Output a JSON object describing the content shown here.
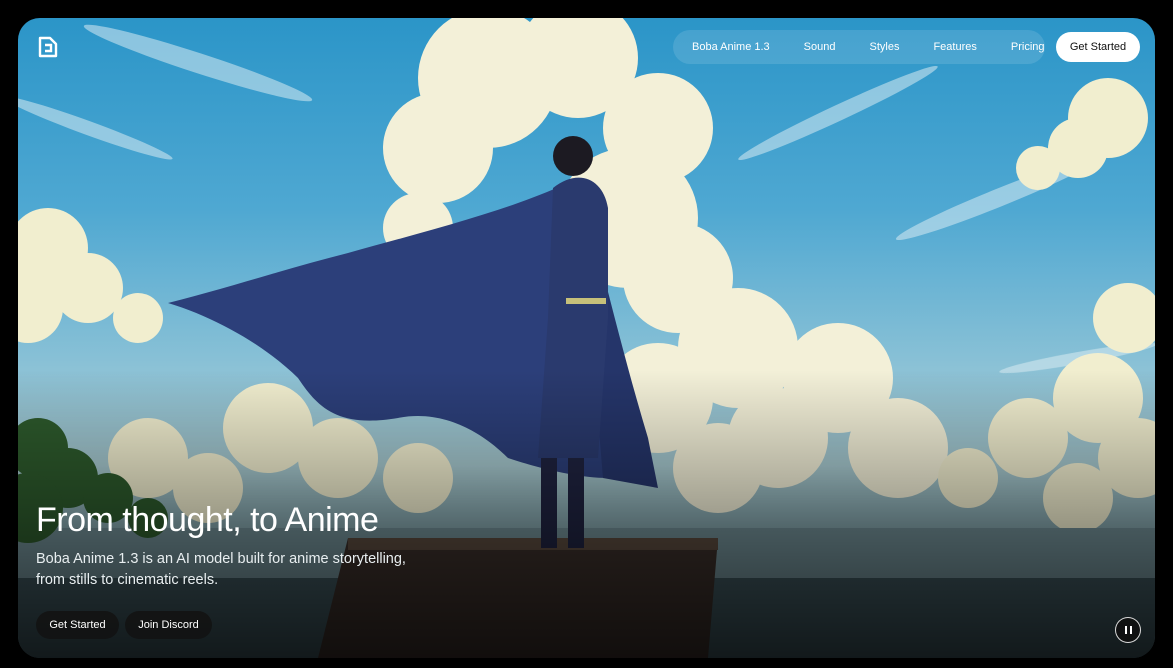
{
  "nav": {
    "items": [
      {
        "label": "Boba Anime 1.3"
      },
      {
        "label": "Sound"
      },
      {
        "label": "Styles"
      },
      {
        "label": "Features"
      },
      {
        "label": "Pricing"
      }
    ],
    "cta_label": "Get Started"
  },
  "hero": {
    "title": "From thought, to Anime",
    "subtitle_line1": "Boba Anime 1.3 is an AI model built for anime storytelling,",
    "subtitle_line2": "from stills to cinematic reels.",
    "primary_label": "Get Started",
    "secondary_label": "Join Discord"
  },
  "media": {
    "control_icon": "pause-icon"
  },
  "colors": {
    "sky": "#2b95c8",
    "cloud": "#f3f0d8",
    "cape": "#2c3f7a",
    "button_light": "#ffffff",
    "button_dark": "#121212"
  }
}
